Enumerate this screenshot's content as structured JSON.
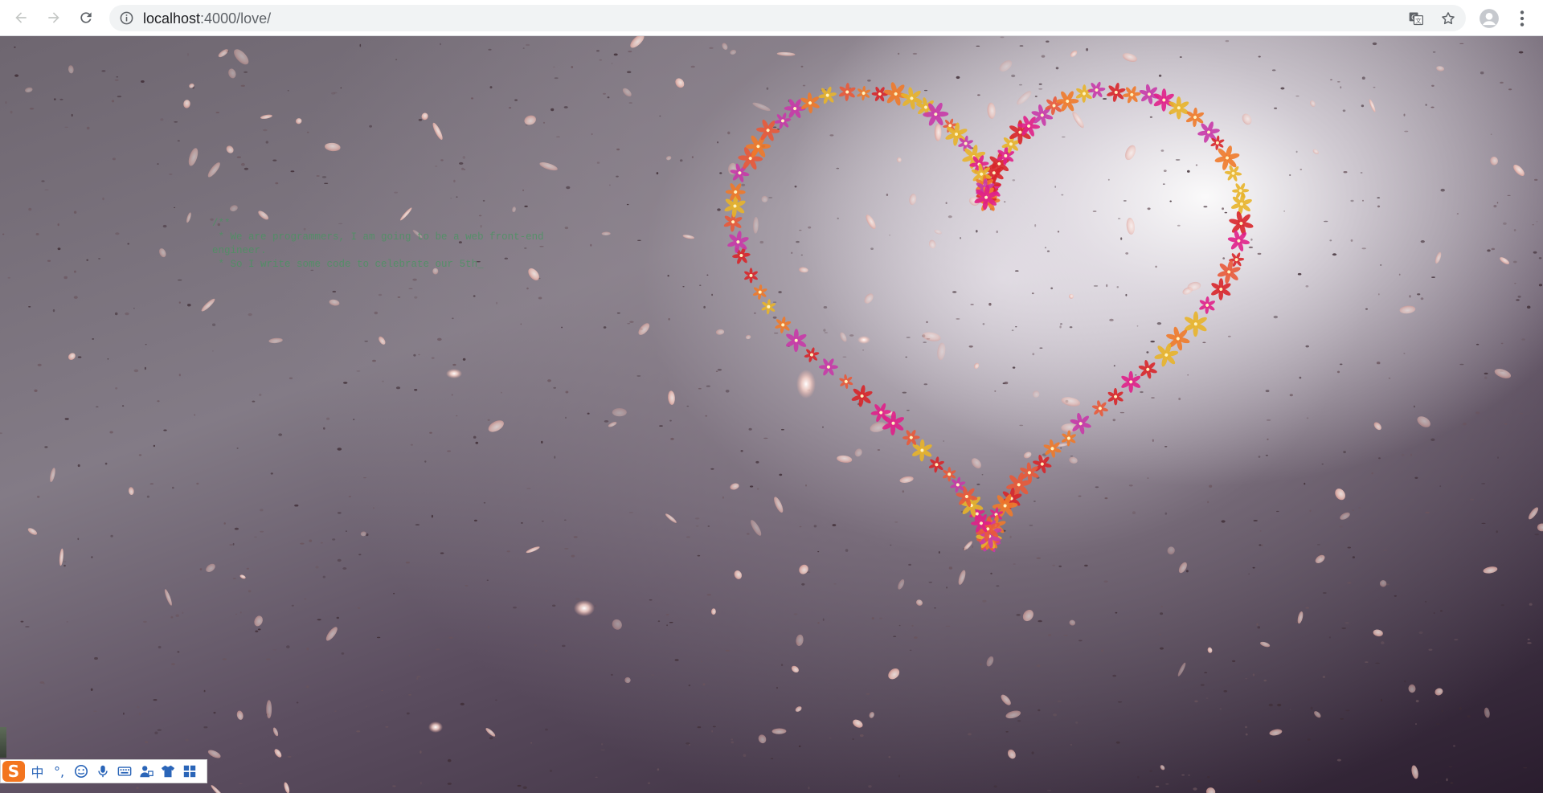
{
  "browser": {
    "url_host": "localhost",
    "url_path": ":4000/love/",
    "back_icon": "back-arrow-icon",
    "forward_icon": "forward-arrow-icon",
    "reload_icon": "reload-icon",
    "info_icon": "site-info-icon",
    "translate_icon": "translate-icon",
    "bookmark_icon": "star-icon",
    "profile_icon": "profile-avatar-icon",
    "menu_icon": "kebab-menu-icon"
  },
  "page": {
    "code_comment": "/**\n * We are programmers, I am going to be a web front-end\nengineer.\n * So I write some code to celebrate our 5th_",
    "scene": "heart-of-flowers-with-falling-petals",
    "colors": {
      "flower_magenta": "#e0208a",
      "flower_orange": "#f07a2a",
      "flower_red": "#d8262a",
      "flower_gold": "#e8b42a",
      "petal": "#f3c9c0",
      "comment": "#4a9a60"
    }
  },
  "ime_toolbar": {
    "logo": "S",
    "mode_label": "中",
    "punct_label": "°,",
    "items": [
      "emoji-icon",
      "microphone-icon",
      "keyboard-icon",
      "user-tool-icon",
      "skin-shirt-icon",
      "grid-apps-icon"
    ]
  }
}
